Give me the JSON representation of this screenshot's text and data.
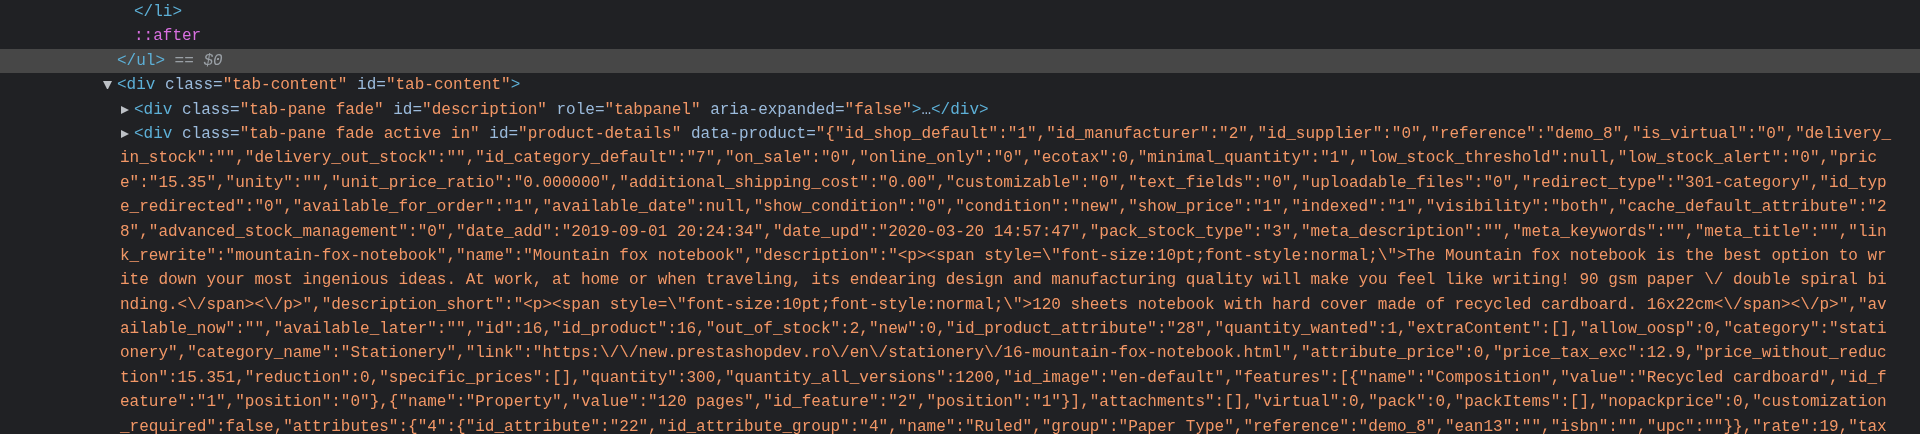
{
  "tree": [
    {
      "selected": true,
      "segments": [
        {
          "kind": "tag",
          "text": "</ul>"
        },
        {
          "kind": "hint",
          "text": " == $0"
        }
      ],
      "children": [
        {
          "selected": false,
          "segments": [
            {
              "kind": "tag",
              "text": "</li>"
            }
          ]
        },
        {
          "selected": false,
          "segments": [
            {
              "kind": "pseudo",
              "text": "::after"
            }
          ]
        }
      ]
    },
    {
      "selected": false,
      "expanded": true,
      "segments": [
        {
          "kind": "tag",
          "text": "<div"
        },
        {
          "kind": "attr_name",
          "text": " class"
        },
        {
          "kind": "punct",
          "text": "="
        },
        {
          "kind": "attr_value",
          "text": "\"tab-content\""
        },
        {
          "kind": "attr_name",
          "text": " id"
        },
        {
          "kind": "punct",
          "text": "="
        },
        {
          "kind": "attr_value",
          "text": "\"tab-content\""
        },
        {
          "kind": "tag",
          "text": ">"
        }
      ],
      "children": [
        {
          "selected": false,
          "expanded": false,
          "segments": [
            {
              "kind": "tag",
              "text": "<div"
            },
            {
              "kind": "attr_name",
              "text": " class"
            },
            {
              "kind": "punct",
              "text": "="
            },
            {
              "kind": "attr_value",
              "text": "\"tab-pane fade\""
            },
            {
              "kind": "attr_name",
              "text": " id"
            },
            {
              "kind": "punct",
              "text": "="
            },
            {
              "kind": "attr_value",
              "text": "\"description\""
            },
            {
              "kind": "attr_name",
              "text": " role"
            },
            {
              "kind": "punct",
              "text": "="
            },
            {
              "kind": "attr_value",
              "text": "\"tabpanel\""
            },
            {
              "kind": "attr_name",
              "text": " aria-expanded"
            },
            {
              "kind": "punct",
              "text": "="
            },
            {
              "kind": "attr_value",
              "text": "\"false\""
            },
            {
              "kind": "tag",
              "text": ">"
            },
            {
              "kind": "punct",
              "text": "…"
            },
            {
              "kind": "tag",
              "text": "</div>"
            }
          ]
        },
        {
          "selected": false,
          "expanded": false,
          "segments": [
            {
              "kind": "tag",
              "text": "<div"
            },
            {
              "kind": "attr_name",
              "text": " class"
            },
            {
              "kind": "punct",
              "text": "="
            },
            {
              "kind": "attr_value",
              "text": "\"tab-pane fade active in\""
            },
            {
              "kind": "attr_name",
              "text": " id"
            },
            {
              "kind": "punct",
              "text": "="
            },
            {
              "kind": "attr_value",
              "text": "\"product-details\""
            },
            {
              "kind": "attr_name",
              "text": " data-product"
            },
            {
              "kind": "punct",
              "text": "="
            },
            {
              "kind": "attr_value",
              "text": "\"{\"id_shop_default\":\"1\",\"id_manufacturer\":\"2\",\"id_supplier\":\"0\",\"reference\":\"demo_8\",\"is_virtual\":\"0\",\"delivery_"
            }
          ],
          "wrapped_lines": [
            "in_stock\":\"\",\"delivery_out_stock\":\"\",\"id_category_default\":\"7\",\"on_sale\":\"0\",\"online_only\":\"0\",\"ecotax\":0,\"minimal_quantity\":\"1\",\"low_stock_threshold\":null,\"low_stock_alert\":\"0\",\"pric",
            "e\":\"15.35\",\"unity\":\"\",\"unit_price_ratio\":\"0.000000\",\"additional_shipping_cost\":\"0.00\",\"customizable\":\"0\",\"text_fields\":\"0\",\"uploadable_files\":\"0\",\"redirect_type\":\"301-category\",\"id_typ",
            "e_redirected\":\"0\",\"available_for_order\":\"1\",\"available_date\":null,\"show_condition\":\"0\",\"condition\":\"new\",\"show_price\":\"1\",\"indexed\":\"1\",\"visibility\":\"both\",\"cache_default_attribute\":\"2",
            "8\",\"advanced_stock_management\":\"0\",\"date_add\":\"2019-09-01 20:24:34\",\"date_upd\":\"2020-03-20 14:57:47\",\"pack_stock_type\":\"3\",\"meta_description\":\"\",\"meta_keywords\":\"\",\"meta_title\":\"\",\"lin",
            "k_rewrite\":\"mountain-fox-notebook\",\"name\":\"Mountain fox notebook\",\"description\":\"<p><span style=\\\"font-size:10pt;font-style:normal;\\\">The Mountain fox notebook is the best option to wr",
            "ite down your most ingenious ideas. At work, at home or when traveling, its endearing design and manufacturing quality will make you feel like writing! 90 gsm paper \\/ double spiral bi",
            "nding.<\\/span><\\/p>\",\"description_short\":\"<p><span style=\\\"font-size:10pt;font-style:normal;\\\">120 sheets notebook with hard cover made of recycled cardboard. 16x22cm<\\/span><\\/p>\",\"av",
            "ailable_now\":\"\",\"available_later\":\"\",\"id\":16,\"id_product\":16,\"out_of_stock\":2,\"new\":0,\"id_product_attribute\":\"28\",\"quantity_wanted\":1,\"extraContent\":[],\"allow_oosp\":0,\"category\":\"stati",
            "onery\",\"category_name\":\"Stationery\",\"link\":\"https:\\/\\/new.prestashopdev.ro\\/en\\/stationery\\/16-mountain-fox-notebook.html\",\"attribute_price\":0,\"price_tax_exc\":12.9,\"price_without_reduc",
            "tion\":15.351,\"reduction\":0,\"specific_prices\":[],\"quantity\":300,\"quantity_all_versions\":1200,\"id_image\":\"en-default\",\"features\":[{\"name\":\"Composition\",\"value\":\"Recycled cardboard\",\"id_f",
            "eature\":\"1\",\"position\":\"0\"},{\"name\":\"Property\",\"value\":\"120 pages\",\"id_feature\":\"2\",\"position\":\"1\"}],\"attachments\":[],\"virtual\":0,\"pack\":0,\"packItems\":[],\"nopackprice\":0,\"customization",
            "_required\":false,\"attributes\":{\"4\":{\"id_attribute\":\"22\",\"id_attribute_group\":\"4\",\"name\":\"Ruled\",\"group\":\"Paper Type\",\"reference\":\"demo_8\",\"ean13\":\"\",\"isbn\":\"\",\"upc\":\"\"}},\"rate\":19,\"tax"
          ]
        }
      ]
    }
  ]
}
